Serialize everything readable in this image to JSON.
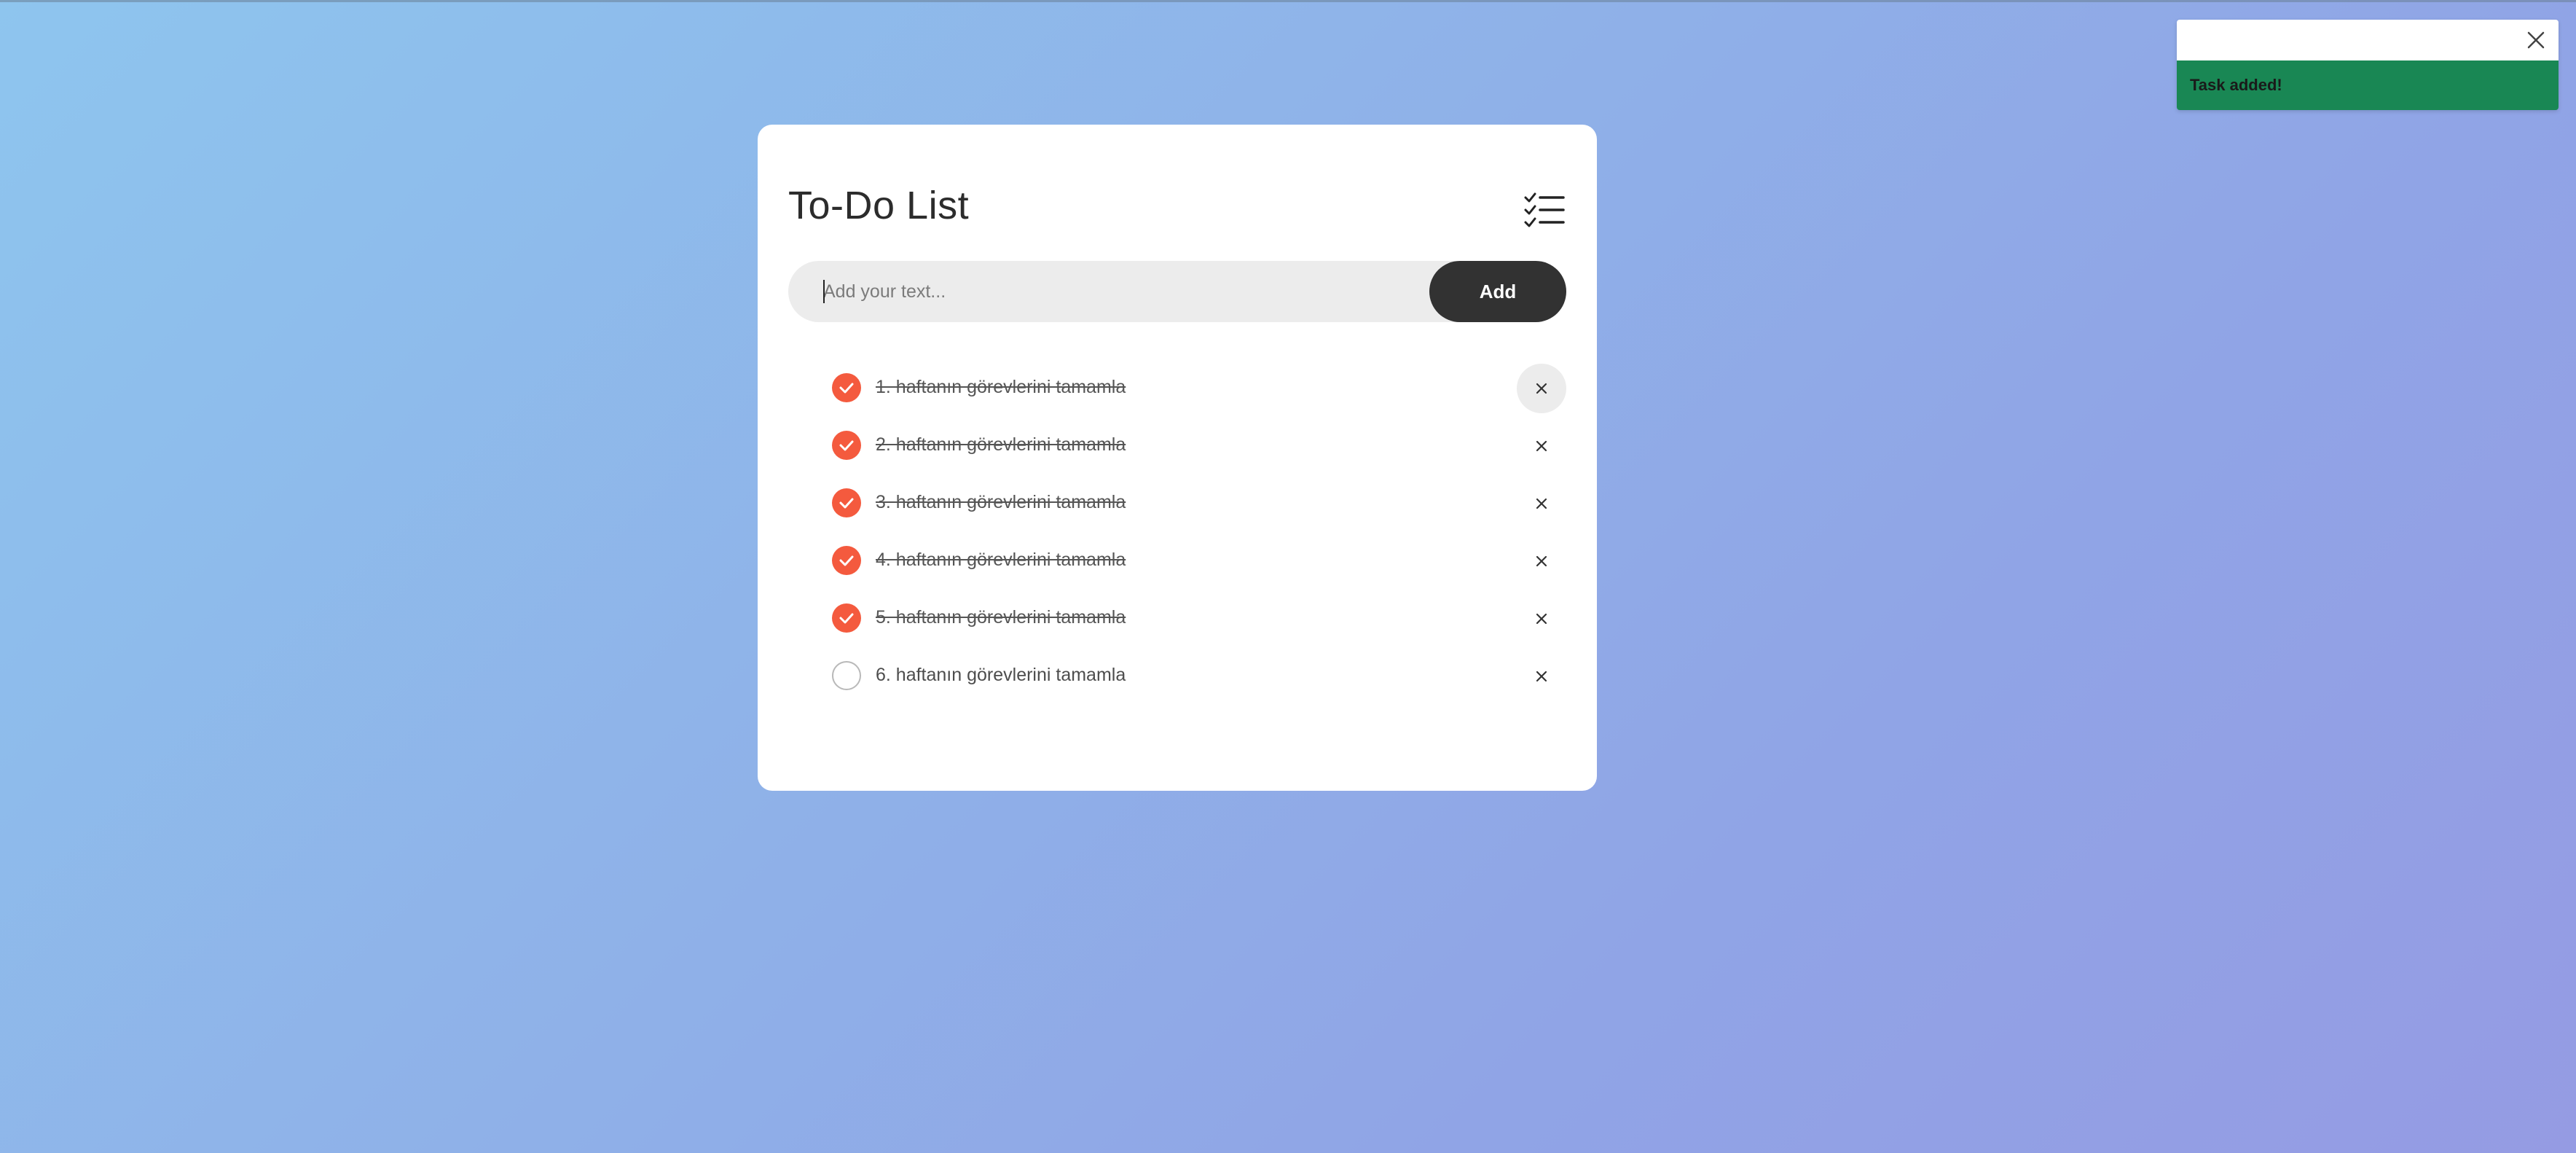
{
  "app": {
    "title": "To-Do List",
    "header_icon": "checklist-icon"
  },
  "input": {
    "value": "",
    "placeholder": "Add your text...",
    "add_label": "Add"
  },
  "tasks": [
    {
      "text": "1. haftanın görevlerini tamamla",
      "completed": true
    },
    {
      "text": "2. haftanın görevlerini tamamla",
      "completed": true
    },
    {
      "text": "3. haftanın görevlerini tamamla",
      "completed": true
    },
    {
      "text": "4. haftanın görevlerini tamamla",
      "completed": true
    },
    {
      "text": "5. haftanın görevlerini tamamla",
      "completed": true
    },
    {
      "text": "6. haftanın görevlerini tamamla",
      "completed": false
    }
  ],
  "delete_icon": "close-icon",
  "toast": {
    "message": "Task added!",
    "close_icon": "close-icon"
  },
  "colors": {
    "accent": "#f45a3e",
    "button": "#323232",
    "toast_success": "#198754"
  }
}
